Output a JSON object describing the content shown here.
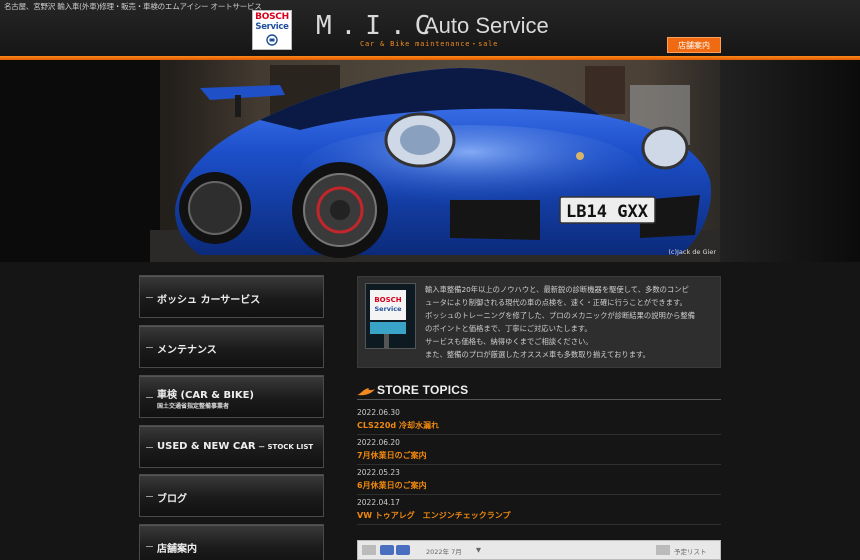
{
  "header": {
    "tagline": "名古屋、宮野沢 輸入車(外車)修理・販売・車検のエムアイシー オートサービス",
    "bosch_line1": "BOSCH",
    "bosch_line2": "Service",
    "logo_main": "M.I.C",
    "logo_auto": "Auto Service",
    "logo_sub": "Car & Bike maintenance・sale",
    "store_button": "店舗案内"
  },
  "hero": {
    "plate": "LB14 GXX",
    "credit": "(c)Jack de Gier"
  },
  "sidebar": {
    "items": [
      {
        "label": "ボッシュ カーサービス",
        "sub": ""
      },
      {
        "label": "メンテナンス",
        "sub": ""
      },
      {
        "label": "車検 (CAR & BIKE)",
        "sub": "国土交通省指定整備事業者"
      },
      {
        "label": "USED & NEW CAR",
        "small": " － STOCK LIST",
        "sub": ""
      },
      {
        "label": "ブログ",
        "sub": ""
      },
      {
        "label": "店舗案内",
        "sub": ""
      }
    ]
  },
  "intro": {
    "sign_line1": "BOSCH",
    "sign_line2": "Service",
    "lines": [
      "輸入車整備20年以上のノウハウと、最新鋭の診断機器を駆使して、多数のコンピ",
      "ュータにより制御される現代の車の点検を、速く・正確に行うことができます。",
      "ボッシュのトレーニングを修了した、プロのメカニックが診断結果の説明から整備",
      "のポイントと価格まで、丁寧にご対応いたします。",
      "サービスも価格も、納得ゆくまでご相談ください。",
      "また、整備のプロが厳選したオススメ車も多数取り揃えております。"
    ]
  },
  "topics": {
    "title": "STORE TOPICS",
    "items": [
      {
        "date": "2022.06.30",
        "title": "CLS220d 冷却水漏れ"
      },
      {
        "date": "2022.06.20",
        "title": "7月休業日のご案内"
      },
      {
        "date": "2022.05.23",
        "title": "6月休業日のご案内"
      },
      {
        "date": "2022.04.17",
        "title": "VW トゥアレグ　エンジンチェックランプ"
      }
    ]
  },
  "calendar": {
    "month": "2022年 7月",
    "arrow": "▼",
    "schedule": "予定リスト"
  },
  "colors": {
    "accent": "#f0890e",
    "store_button": "#ef6a10",
    "car_blue": "#1c4fc9"
  }
}
